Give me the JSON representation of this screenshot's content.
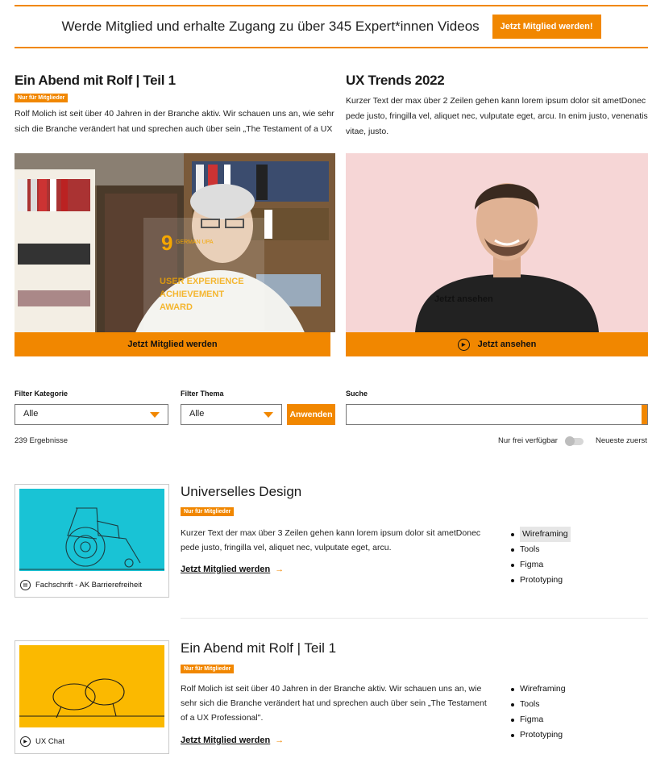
{
  "banner": {
    "text": "Werde Mitglied und erhalte Zugang zu über 345 Expert*innen Videos",
    "button": "Jetzt Mitglied werden!"
  },
  "featured": [
    {
      "title": "Ein Abend mit Rolf | Teil 1",
      "badge": "Nur für Mitglieder",
      "description": "Rolf Molich ist seit über 40 Jahren in der Branche aktiv. Wir schauen uns an, wie sehr sich die Branche verändert hat und sprechen auch über sein „The Testament of a UX",
      "cta": "Jetzt Mitglied werden",
      "overlay": {
        "logo": "GERMAN UPA",
        "award": "Rolf Molich\nGERMAN UPA\nUSER EXPERIENCE\nACHIEVEMENT\nAWARD"
      }
    },
    {
      "title": "UX Trends 2022",
      "description": "Kurzer Text der max über 2 Zeilen gehen kann lorem ipsum dolor sit ametDonec pede justo, fringilla vel, aliquet nec, vulputate eget, arcu. In enim justo, venenatis vitae, justo.",
      "overlay_text": "Jetzt ansehen",
      "cta": "Jetzt ansehen"
    }
  ],
  "filters": {
    "category_label": "Filter Kategorie",
    "category_value": "Alle",
    "topic_label": "Filter Thema",
    "topic_value": "Alle",
    "apply": "Anwenden",
    "search_label": "Suche",
    "search_value": ""
  },
  "results": {
    "count": "239 Ergebnisse",
    "free_only": "Nur frei verfügbar",
    "sort": "Neueste zuerst"
  },
  "cards": [
    {
      "title": "Universelles Design",
      "badge": "Nur für Mitglieder",
      "description": "Kurzer Text der max über 3 Zeilen gehen kann lorem ipsum dolor sit ametDonec pede justo, fringilla vel, aliquet nec, vulputate eget, arcu.",
      "link": "Jetzt Mitglied werden",
      "thumb_label": "Fachschrift - AK Barrierefreiheit",
      "thumb_color": "#19c3d5",
      "tags": [
        "Wireframing",
        "Tools",
        "Figma",
        "Prototyping"
      ]
    },
    {
      "title": "Ein Abend mit Rolf | Teil 1",
      "badge": "Nur für Mitglieder",
      "description": "Rolf Molich ist seit über 40 Jahren in der Branche aktiv. Wir schauen uns an, wie sehr sich die Branche verändert hat und sprechen auch über sein „The Testament of a UX Professional\".",
      "link": "Jetzt Mitglied werden",
      "thumb_label": "UX Chat",
      "thumb_color": "#fbb900",
      "tags": [
        "Wireframing",
        "Tools",
        "Figma",
        "Prototyping"
      ]
    }
  ],
  "colors": {
    "accent": "#f18700",
    "page_bg": "#ffffff"
  }
}
